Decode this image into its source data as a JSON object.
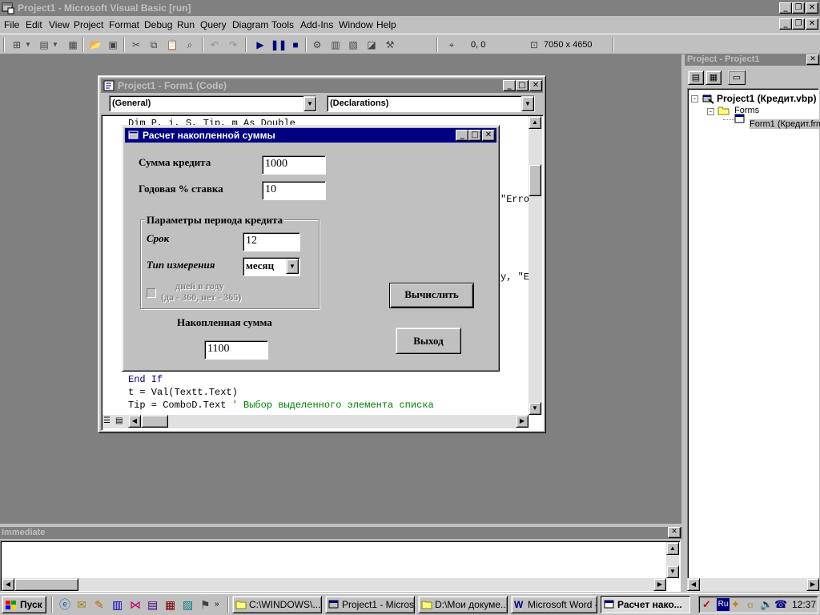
{
  "window": {
    "title": "Project1 - Microsoft Visual Basic [run]"
  },
  "menu": [
    "File",
    "Edit",
    "View",
    "Project",
    "Format",
    "Debug",
    "Run",
    "Query",
    "Diagram",
    "Tools",
    "Add-Ins",
    "Window",
    "Help"
  ],
  "toolbar": {
    "coords": "0, 0",
    "size": "7050 x 4650"
  },
  "code_window": {
    "title": "Project1 - Form1 (Code)",
    "object_combo": "(General)",
    "proc_combo": "(Declarations)",
    "lines": {
      "l1": "Dim P, i, S, Tip, m As Double",
      "l2": "\"Erro",
      "l3": "y, \"E",
      "l4_kw": "End If",
      "l5": "t = Val(Textt.Text)",
      "l6_code": "Tip = ComboD.Text ",
      "l6_comment": "' Выбор выделенного элемента списка"
    }
  },
  "form": {
    "title": "Расчет накопленной суммы",
    "loan_label": "Сумма кредита",
    "loan_value": "1000",
    "rate_label": "Годовая % ставка",
    "rate_value": "10",
    "group_title": "Параметры периода кредита",
    "term_label": "Срок",
    "term_value": "12",
    "unit_label": "Тип измерения",
    "unit_value": "месяц",
    "days_check_line1": "дней в году",
    "days_check_line2": "(да - 360, нет - 365)",
    "result_label": "Накопленная сумма",
    "result_value": "1100",
    "calc_button": "Вычислить",
    "exit_button": "Выход"
  },
  "project_explorer": {
    "title": "Project - Project1",
    "project": "Project1 (Кредит.vbp)",
    "folder": "Forms",
    "form_item": "Form1 (Кредит.frm)"
  },
  "immediate": {
    "title": "Immediate"
  },
  "taskbar": {
    "start": "Пуск",
    "tasks": [
      "C:\\WINDOWS\\...",
      "Project1 - Micros...",
      "D:\\Мои докуме...",
      "Microsoft Word -...",
      "Расчет нако..."
    ],
    "lang": "Ru",
    "clock": "12:37"
  },
  "colors": {
    "mdi_bg": "#808080",
    "title_active": "#000080",
    "title_inactive": "#808080",
    "face": "#c0c0c0",
    "keyword": "#000080",
    "comment": "#008000"
  },
  "icons": [
    "vb-app-icon",
    "code-window-icon",
    "form-icon",
    "project-icon",
    "folder-icon",
    "windows-flag-icon"
  ]
}
